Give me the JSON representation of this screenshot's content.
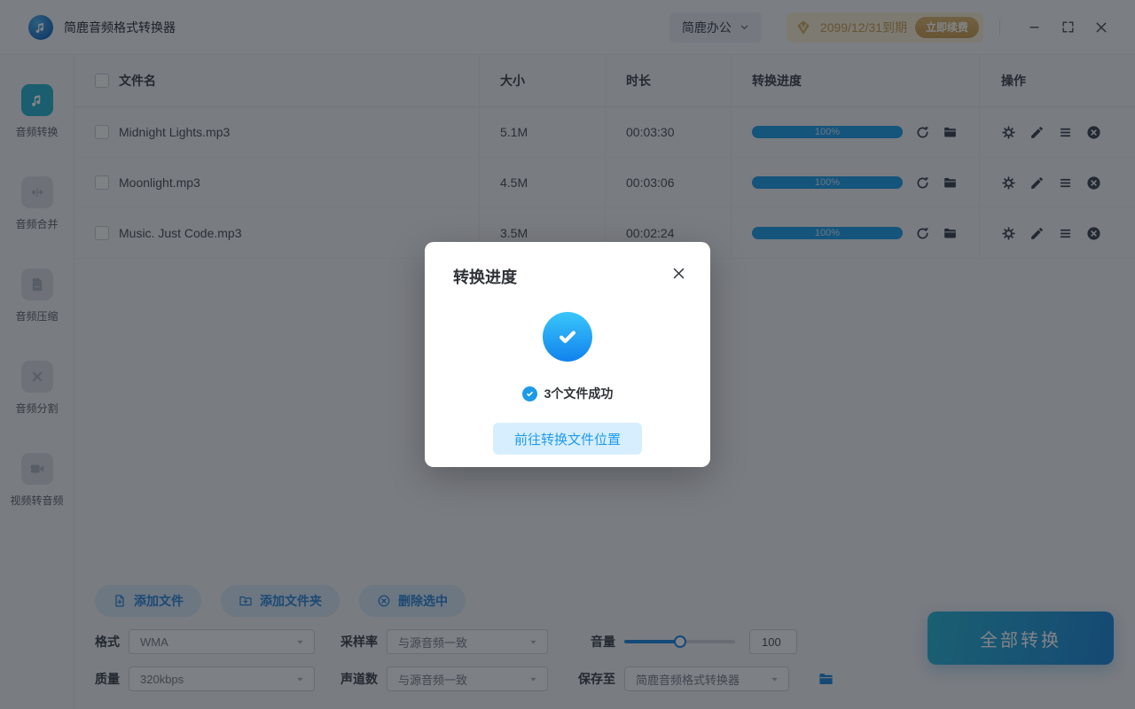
{
  "window": {
    "app_title": "简鹿音频格式转换器",
    "menu_label": "简鹿办公",
    "vip_expiry": "2099/12/31到期",
    "renew_label": "立即续费"
  },
  "sidebar": {
    "items": [
      {
        "label": "音频转换",
        "active": true
      },
      {
        "label": "音频合并",
        "active": false
      },
      {
        "label": "音频压缩",
        "active": false
      },
      {
        "label": "音频分割",
        "active": false
      },
      {
        "label": "视频转音频",
        "active": false
      }
    ]
  },
  "table": {
    "headers": [
      "文件名",
      "大小",
      "时长",
      "转换进度",
      "操作"
    ],
    "rows": [
      {
        "name": "Midnight Lights.mp3",
        "size": "5.1M",
        "duration": "00:03:30",
        "progress": "100%"
      },
      {
        "name": "Moonlight.mp3",
        "size": "4.5M",
        "duration": "00:03:06",
        "progress": "100%"
      },
      {
        "name": "Music. Just Code.mp3",
        "size": "3.5M",
        "duration": "00:02:24",
        "progress": "100%"
      }
    ]
  },
  "toolbar": {
    "add_file": "添加文件",
    "add_folder": "添加文件夹",
    "delete_selected": "删除选中"
  },
  "settings": {
    "format_label": "格式",
    "format_value": "WMA",
    "sample_rate_label": "采样率",
    "sample_rate_value": "与源音频一致",
    "volume_label": "音量",
    "volume_value": "100",
    "quality_label": "质量",
    "quality_value": "320kbps",
    "channels_label": "声道数",
    "channels_value": "与源音频一致",
    "save_to_label": "保存至",
    "save_to_value": "简鹿音频格式转换器"
  },
  "convert_all_label": "全部转换",
  "modal": {
    "title": "转换进度",
    "success_text": "3个文件成功",
    "action_label": "前往转换文件位置"
  },
  "colors": {
    "accent_blue": "#1e87e0",
    "progress_fill": "#1f9de8",
    "active_tile_teal": "#29b2d2",
    "gold": "#c9a159",
    "modal_check_gradient_top": "#3ac6fa",
    "modal_check_gradient_bottom": "#1182ee"
  }
}
